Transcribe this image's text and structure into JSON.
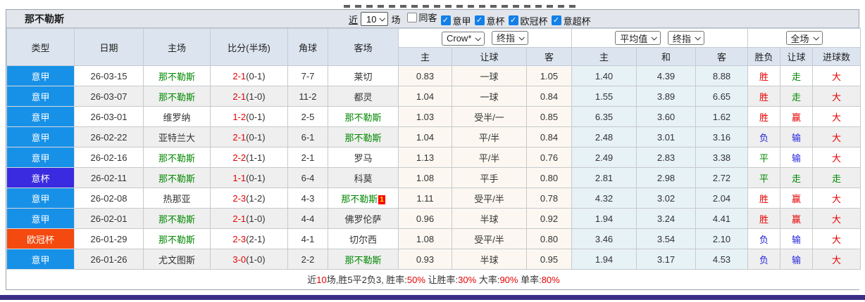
{
  "title": "那不勒斯",
  "controls": {
    "recent_label": "近",
    "recent_value": "10",
    "matches_label": "场",
    "filters": [
      {
        "label": "同客",
        "checked": false
      },
      {
        "label": "意甲",
        "checked": true
      },
      {
        "label": "意杯",
        "checked": true
      },
      {
        "label": "欧冠杯",
        "checked": true
      },
      {
        "label": "意超杯",
        "checked": true
      }
    ]
  },
  "header": {
    "static_cols": [
      "类型",
      "日期",
      "主场",
      "比分(半场)",
      "角球",
      "客场"
    ],
    "group1": {
      "dd1": "Crow*",
      "dd2": "终指",
      "cols": [
        "主",
        "让球",
        "客"
      ]
    },
    "group2": {
      "dd1": "平均值",
      "dd2": "终指",
      "cols": [
        "主",
        "和",
        "客"
      ]
    },
    "group3": {
      "dd1": "全场",
      "cols": [
        "胜负",
        "让球",
        "进球数"
      ]
    }
  },
  "colors": {
    "league_seriea": "#1791e8",
    "league_cup": "#3a2be0",
    "league_ucl": "#f4490f",
    "win_red": "#e60000",
    "draw_green": "#008800",
    "loss_blue": "#2525dd",
    "highlight_team_green": "#008800",
    "checkbox_blue": "#1380e8",
    "bottom_bar_purple": "#3a2e86"
  },
  "rows": [
    {
      "league": "意甲",
      "league_type": "seriea",
      "date": "26-03-15",
      "home": "那不勒斯",
      "home_hl": true,
      "score": "2-1",
      "half": "(0-1)",
      "corner": "7-7",
      "away": "莱切",
      "away_hl": false,
      "away_badge": "",
      "odds": [
        "0.83",
        "一球",
        "1.05"
      ],
      "avg": [
        "1.40",
        "4.39",
        "8.88"
      ],
      "results": [
        {
          "t": "胜",
          "c": "red"
        },
        {
          "t": "走",
          "c": "green"
        },
        {
          "t": "大",
          "c": "red"
        }
      ]
    },
    {
      "league": "意甲",
      "league_type": "seriea",
      "date": "26-03-07",
      "home": "那不勒斯",
      "home_hl": true,
      "score": "2-1",
      "half": "(1-0)",
      "corner": "11-2",
      "away": "都灵",
      "away_hl": false,
      "away_badge": "",
      "odds": [
        "1.04",
        "一球",
        "0.84"
      ],
      "avg": [
        "1.55",
        "3.89",
        "6.65"
      ],
      "results": [
        {
          "t": "胜",
          "c": "red"
        },
        {
          "t": "走",
          "c": "green"
        },
        {
          "t": "大",
          "c": "red"
        }
      ]
    },
    {
      "league": "意甲",
      "league_type": "seriea",
      "date": "26-03-01",
      "home": "维罗纳",
      "home_hl": false,
      "score": "1-2",
      "half": "(0-1)",
      "corner": "2-5",
      "away": "那不勒斯",
      "away_hl": true,
      "away_badge": "",
      "odds": [
        "1.03",
        "受半/一",
        "0.85"
      ],
      "avg": [
        "6.35",
        "3.60",
        "1.62"
      ],
      "results": [
        {
          "t": "胜",
          "c": "red"
        },
        {
          "t": "赢",
          "c": "red"
        },
        {
          "t": "大",
          "c": "red"
        }
      ]
    },
    {
      "league": "意甲",
      "league_type": "seriea",
      "date": "26-02-22",
      "home": "亚特兰大",
      "home_hl": false,
      "score": "2-1",
      "half": "(0-1)",
      "corner": "6-1",
      "away": "那不勒斯",
      "away_hl": true,
      "away_badge": "",
      "odds": [
        "1.04",
        "平/半",
        "0.84"
      ],
      "avg": [
        "2.48",
        "3.01",
        "3.16"
      ],
      "results": [
        {
          "t": "负",
          "c": "blue"
        },
        {
          "t": "输",
          "c": "blue"
        },
        {
          "t": "大",
          "c": "red"
        }
      ]
    },
    {
      "league": "意甲",
      "league_type": "seriea",
      "date": "26-02-16",
      "home": "那不勒斯",
      "home_hl": true,
      "score": "2-2",
      "half": "(1-1)",
      "corner": "2-1",
      "away": "罗马",
      "away_hl": false,
      "away_badge": "",
      "odds": [
        "1.13",
        "平/半",
        "0.76"
      ],
      "avg": [
        "2.49",
        "2.83",
        "3.38"
      ],
      "results": [
        {
          "t": "平",
          "c": "green"
        },
        {
          "t": "输",
          "c": "blue"
        },
        {
          "t": "大",
          "c": "red"
        }
      ]
    },
    {
      "league": "意杯",
      "league_type": "cup",
      "date": "26-02-11",
      "home": "那不勒斯",
      "home_hl": true,
      "score": "1-1",
      "half": "(0-1)",
      "corner": "6-4",
      "away": "科莫",
      "away_hl": false,
      "away_badge": "",
      "odds": [
        "1.08",
        "平手",
        "0.80"
      ],
      "avg": [
        "2.81",
        "2.98",
        "2.72"
      ],
      "results": [
        {
          "t": "平",
          "c": "green"
        },
        {
          "t": "走",
          "c": "green"
        },
        {
          "t": "走",
          "c": "green"
        }
      ]
    },
    {
      "league": "意甲",
      "league_type": "seriea",
      "date": "26-02-08",
      "home": "热那亚",
      "home_hl": false,
      "score": "2-3",
      "half": "(1-2)",
      "corner": "4-3",
      "away": "那不勒斯",
      "away_hl": true,
      "away_badge": "1",
      "odds": [
        "1.11",
        "受平/半",
        "0.78"
      ],
      "avg": [
        "4.32",
        "3.02",
        "2.04"
      ],
      "results": [
        {
          "t": "胜",
          "c": "red"
        },
        {
          "t": "赢",
          "c": "red"
        },
        {
          "t": "大",
          "c": "red"
        }
      ]
    },
    {
      "league": "意甲",
      "league_type": "seriea",
      "date": "26-02-01",
      "home": "那不勒斯",
      "home_hl": true,
      "score": "2-1",
      "half": "(1-0)",
      "corner": "4-4",
      "away": "佛罗伦萨",
      "away_hl": false,
      "away_badge": "",
      "odds": [
        "0.96",
        "半球",
        "0.92"
      ],
      "avg": [
        "1.94",
        "3.24",
        "4.41"
      ],
      "results": [
        {
          "t": "胜",
          "c": "red"
        },
        {
          "t": "赢",
          "c": "red"
        },
        {
          "t": "大",
          "c": "red"
        }
      ]
    },
    {
      "league": "欧冠杯",
      "league_type": "ucl",
      "date": "26-01-29",
      "home": "那不勒斯",
      "home_hl": true,
      "score": "2-3",
      "half": "(2-1)",
      "corner": "4-1",
      "away": "切尔西",
      "away_hl": false,
      "away_badge": "",
      "odds": [
        "1.08",
        "受平/半",
        "0.80"
      ],
      "avg": [
        "3.46",
        "3.54",
        "2.10"
      ],
      "results": [
        {
          "t": "负",
          "c": "blue"
        },
        {
          "t": "输",
          "c": "blue"
        },
        {
          "t": "大",
          "c": "red"
        }
      ]
    },
    {
      "league": "意甲",
      "league_type": "seriea",
      "date": "26-01-26",
      "home": "尤文图斯",
      "home_hl": false,
      "score": "3-0",
      "half": "(1-0)",
      "corner": "2-2",
      "away": "那不勒斯",
      "away_hl": true,
      "away_badge": "",
      "odds": [
        "0.93",
        "半球",
        "0.95"
      ],
      "avg": [
        "1.94",
        "3.17",
        "4.53"
      ],
      "results": [
        {
          "t": "负",
          "c": "blue"
        },
        {
          "t": "输",
          "c": "blue"
        },
        {
          "t": "大",
          "c": "red"
        }
      ]
    }
  ],
  "summary": [
    {
      "text": "近",
      "red": false
    },
    {
      "text": "10",
      "red": true
    },
    {
      "text": "场,胜5平2负3, 胜率:",
      "red": false
    },
    {
      "text": "50%",
      "red": true
    },
    {
      "text": " 让胜率:",
      "red": false
    },
    {
      "text": "30%",
      "red": true
    },
    {
      "text": " 大率:",
      "red": false
    },
    {
      "text": "90%",
      "red": true
    },
    {
      "text": " 单率:",
      "red": false
    },
    {
      "text": "80%",
      "red": true
    }
  ]
}
